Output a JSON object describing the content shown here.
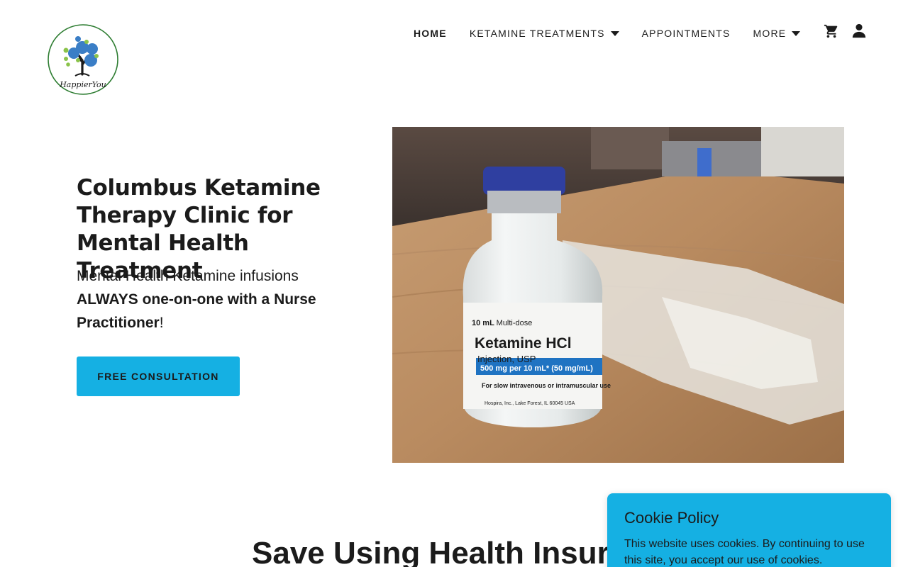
{
  "brand": {
    "logo_text": "HappierYou"
  },
  "nav": {
    "items": [
      {
        "label": "HOME",
        "active": true,
        "has_dropdown": false
      },
      {
        "label": "KETAMINE TREATMENTS",
        "active": false,
        "has_dropdown": true
      },
      {
        "label": "APPOINTMENTS",
        "active": false,
        "has_dropdown": false
      },
      {
        "label": "MORE",
        "active": false,
        "has_dropdown": true
      }
    ],
    "icons": [
      "cart-icon",
      "account-icon"
    ]
  },
  "hero": {
    "title": "Columbus Ketamine Therapy Clinic for Mental Health Treatment",
    "subtitle_line1": "Mental Health Ketamine infusions",
    "subtitle_bold": "ALWAYS one-on-one with a Nurse Practitioner",
    "subtitle_end": "!",
    "cta_label": "FREE CONSULTATION",
    "image": {
      "vial_volume": "10 mL",
      "vial_dose_type": "Multi-dose",
      "vial_drug": "Ketamine HCl",
      "vial_form": "Injection, USP",
      "vial_strength": "500 mg per 10 mL* (50 mg/mL)",
      "vial_route": "For slow intravenous or intramuscular use",
      "vial_maker": "Hospira, Inc., Lake Forest, IL 60045 USA"
    }
  },
  "section": {
    "heading": "Save Using Health Insurance"
  },
  "cookie": {
    "title": "Cookie Policy",
    "text": "This website uses cookies. By continuing to use this site, you accept our use of cookies."
  },
  "colors": {
    "accent": "#15b0e3",
    "text": "#1b1b1b",
    "background": "#ffffff"
  }
}
